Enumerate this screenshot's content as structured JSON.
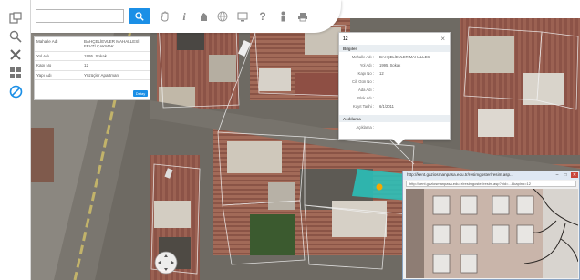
{
  "toolbar": {
    "search_value": "",
    "search_icon": "search-icon",
    "tools": [
      "hand-icon",
      "info-icon",
      "building-icon",
      "globe-icon",
      "monitor-icon",
      "help-icon",
      "person-icon",
      "print-icon"
    ]
  },
  "sidebar": {
    "items": [
      "layers-icon",
      "zoom-icon",
      "clear-icon",
      "grid-icon",
      "forbidden-icon"
    ]
  },
  "info_table": {
    "rows": [
      {
        "key": "Mahalle Adı",
        "value": "BAHÇELİEVLER MAHALLESİ FEVZİ ÇAKMAK"
      },
      {
        "key": "Yol Adı",
        "value": "1995. Sokak"
      },
      {
        "key": "Kapı No",
        "value": "12"
      },
      {
        "key": "Yapı Adı",
        "value": "Yüzüçler Apartmanı"
      }
    ],
    "detail_button": "Detay"
  },
  "popup": {
    "title": "12",
    "section1": "Bilgiler",
    "rows": [
      {
        "key": "Mahalle Adı :",
        "value": "BAHÇELİEVLER MAHALLESİ"
      },
      {
        "key": "Yol Adı :",
        "value": "1995. Sokak"
      },
      {
        "key": "Kapı No :",
        "value": "12"
      },
      {
        "key": "Cilt Gün No :",
        "value": ""
      },
      {
        "key": "Ada Adı :",
        "value": ""
      },
      {
        "key": "Blok Adı :",
        "value": ""
      },
      {
        "key": "Kayıt Tarihi :",
        "value": "6/1/2011"
      }
    ],
    "section2": "Açıklama",
    "note_key": "Açıklama :"
  },
  "photo_window": {
    "title": "http://kent.gaziosmanpasa.edu.tr/resimgoster/resim.asp...",
    "url": "http://kent.gaziosmanpasa.edu.tr/resimgoster/resim.asp?pid=...&kapino=12",
    "minimize": "–",
    "maximize": "□",
    "close": "✕"
  },
  "colors": {
    "accent": "#1b8fe6",
    "highlight_parcel": "#27c4bd",
    "road": "#b9ac6e"
  }
}
